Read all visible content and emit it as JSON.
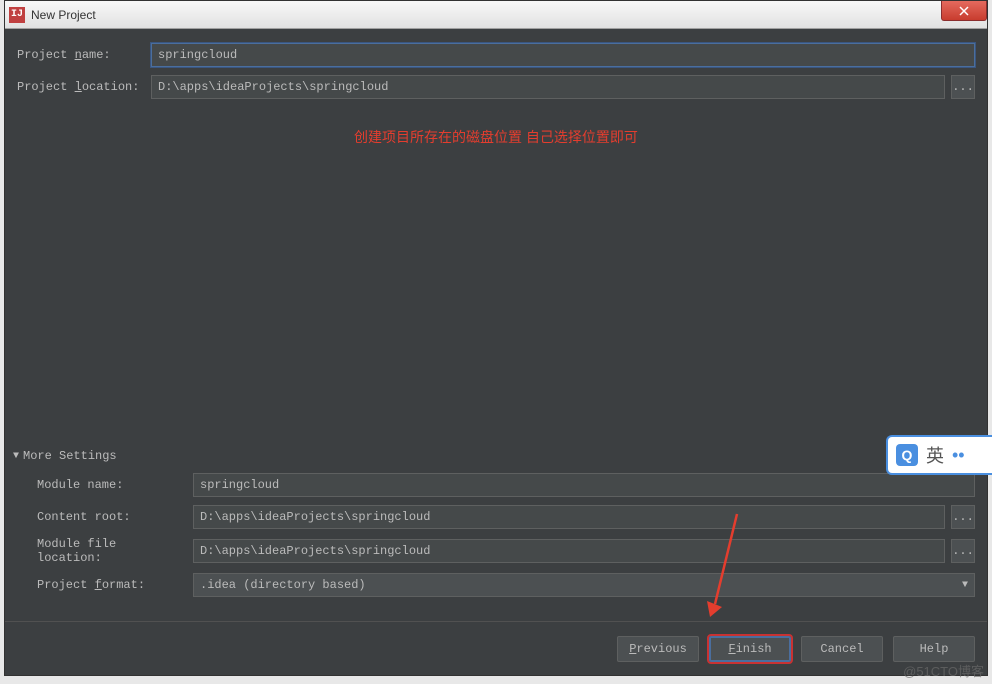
{
  "window": {
    "title": "New Project"
  },
  "form": {
    "projectNameLabel": "Project name:",
    "projectNameValue": "springcloud",
    "projectNameMnemonic": "n",
    "projectLocationLabel": "Project location:",
    "projectLocationValue": "D:\\apps\\ideaProjects\\springcloud",
    "projectLocationMnemonic": "l"
  },
  "annotation": "创建项目所存在的磁盘位置  自己选择位置即可",
  "moreSettings": {
    "header": "More Settings",
    "headerMnemonic": "M",
    "moduleNameLabel": "Module name:",
    "moduleNameValue": "springcloud",
    "contentRootLabel": "Content root:",
    "contentRootValue": "D:\\apps\\ideaProjects\\springcloud",
    "moduleFileLocationLabel": "Module file location:",
    "moduleFileLocationValue": "D:\\apps\\ideaProjects\\springcloud",
    "projectFormatLabel": "Project format:",
    "projectFormatValue": ".idea (directory based)",
    "projectFormatMnemonic": "f"
  },
  "buttons": {
    "previous": "Previous",
    "previousMnemonic": "P",
    "finish": "Finish",
    "finishMnemonic": "F",
    "cancel": "Cancel",
    "help": "Help"
  },
  "ime": {
    "text": "英"
  },
  "watermark": "@51CTO博客",
  "ellipsis": "..."
}
